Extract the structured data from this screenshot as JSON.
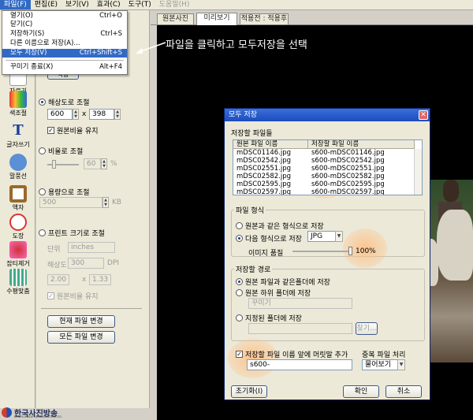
{
  "menubar": {
    "items": [
      "파일(F)",
      "편집(E)",
      "보기(V)",
      "효과(C)",
      "도구(T)",
      "도움말(H)"
    ]
  },
  "file_menu": {
    "items": [
      {
        "label": "열기(O)",
        "shortcut": "Ctrl+O"
      },
      {
        "label": "닫기(C)",
        "shortcut": ""
      },
      {
        "label": "저장하기(S)",
        "shortcut": "Ctrl+S"
      },
      {
        "label": "다른 이름으로 저장(A)...",
        "shortcut": ""
      },
      {
        "label": "모두 저장(V)",
        "shortcut": "Ctrl+Shift+S"
      },
      {
        "label": "꾸미기 종료(X)",
        "shortcut": "Alt+F4"
      }
    ]
  },
  "tabs": [
    "원본사진",
    "미리보기",
    "적용전 : 적용후"
  ],
  "toolbar": {
    "items": [
      "자르기",
      "색조절",
      "글자쓰기",
      "말풍선",
      "액자",
      "도장",
      "잡티제거",
      "수평맞춤"
    ]
  },
  "panel": {
    "resize_by_resolution": "해상도로 조절",
    "width": "600",
    "x_sep": "x",
    "height": "398",
    "keep_ratio": "원본비율 유지",
    "resize_by_ratio": "비율로 조절",
    "ratio_value": "60",
    "percent": "%",
    "resize_by_capacity": "용량으로 조절",
    "capacity_value": "500",
    "kb": "KB",
    "resize_by_print": "프린트 크기로 조절",
    "unit_label": "단위",
    "unit_value": "inches",
    "dpi_label": "해상도",
    "dpi_value": "300",
    "dpi_unit": "DPI",
    "print_w": "2.00",
    "print_x": "x",
    "print_h": "1.33",
    "print_keep_ratio": "원본비율 유지",
    "change_current": "현재 파일 변경",
    "change_all": "모든 파일 변경",
    "top_button": "적용"
  },
  "callout": "파일을 클릭하고 모두저장을 선택",
  "dialog": {
    "title": "모두 저장",
    "files_label": "저장할 파일들",
    "col_original": "원본 파일 이름",
    "col_saved": "저장할 파일 이름",
    "files": [
      {
        "orig": "mDSC01146.jpg",
        "saved": "s600-mDSC01146.jpg"
      },
      {
        "orig": "mDSC02542.jpg",
        "saved": "s600-mDSC02542.jpg"
      },
      {
        "orig": "mDSC02551.jpg",
        "saved": "s600-mDSC02551.jpg"
      },
      {
        "orig": "mDSC02582.jpg",
        "saved": "s600-mDSC02582.jpg"
      },
      {
        "orig": "mDSC02595.jpg",
        "saved": "s600-mDSC02595.jpg"
      },
      {
        "orig": "mDSC02597.jpg",
        "saved": "s600-mDSC02597.jpg"
      }
    ],
    "format_group": "파일 형식",
    "same_format": "원본과 같은 형식으로 저장",
    "other_format": "다음 형식으로 저장",
    "format_value": "JPG",
    "quality_label": "이미지 품질",
    "quality_value": "100%",
    "quality": 1.0,
    "path_group": "저장할 경로",
    "same_folder": "원본 파일과 같은폴더에 저장",
    "sub_folder": "원본 하위 폴더에 저장",
    "sub_folder_value": "꾸미기",
    "chosen_folder": "지정된 폴더에 저장",
    "browse": "찾기...",
    "prefix_check": "저장할 파일 이름 앞에 머릿말 추가",
    "prefix_value": "s600-",
    "dup_label": "중복 파일 처리",
    "dup_value": "물어보기",
    "reset": "초기화(I)",
    "ok": "확인",
    "cancel": "취소"
  },
  "logo": {
    "name": "한국사진방송",
    "sub": "KOREA IMAGE BROADCASTING CO."
  }
}
